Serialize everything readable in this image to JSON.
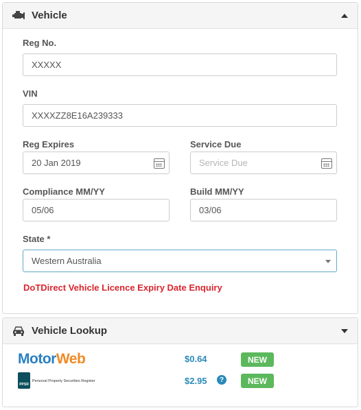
{
  "vehicle_panel": {
    "title": "Vehicle",
    "icon": "engine-icon",
    "reg_no": {
      "label": "Reg No.",
      "value": "XXXXX"
    },
    "vin": {
      "label": "VIN",
      "value": "XXXXZZ8E16A239333"
    },
    "reg_expires": {
      "label": "Reg Expires",
      "value": "20 Jan 2019"
    },
    "service_due": {
      "label": "Service Due",
      "placeholder": "Service Due"
    },
    "compliance": {
      "label": "Compliance MM/YY",
      "value": "05/06"
    },
    "build": {
      "label": "Build MM/YY",
      "value": "03/06"
    },
    "state": {
      "label": "State *",
      "value": "Western Australia"
    },
    "dot_link": "DoTDirect Vehicle Licence Expiry Date Enquiry"
  },
  "lookup_panel": {
    "title": "Vehicle Lookup",
    "icon": "car-icon",
    "providers": [
      {
        "name_part1": "Motor",
        "name_part2": "Web",
        "price": "$0.64",
        "badge": "NEW"
      },
      {
        "logo_text": "PPSR",
        "name": "Personal Property Securities Register",
        "price": "$2.95",
        "help": "?",
        "badge": "NEW"
      }
    ]
  },
  "colors": {
    "link_red": "#d9252e",
    "price_blue": "#2a8ab7",
    "badge_green": "#5cb85c"
  }
}
